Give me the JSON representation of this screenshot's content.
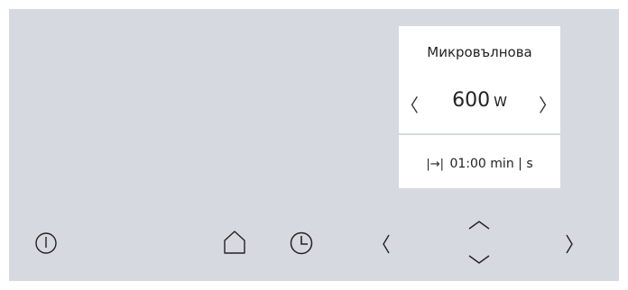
{
  "display": {
    "mode_title": "Микровълнова",
    "power_value": "600",
    "power_unit": "W",
    "prev_arrow": "〈",
    "next_arrow": "〉",
    "timer_icon": "|→|",
    "timer_value": "01:00",
    "timer_unit": "min | s"
  },
  "controls": {
    "icons": [
      "power-icon",
      "home-icon",
      "clock-icon",
      "chevron-left-icon",
      "chevron-up-icon",
      "chevron-down-icon",
      "chevron-right-icon"
    ]
  },
  "colors": {
    "panel_bg": "#d6d9e0",
    "display_bg": "#ffffff",
    "text": "#222222"
  }
}
